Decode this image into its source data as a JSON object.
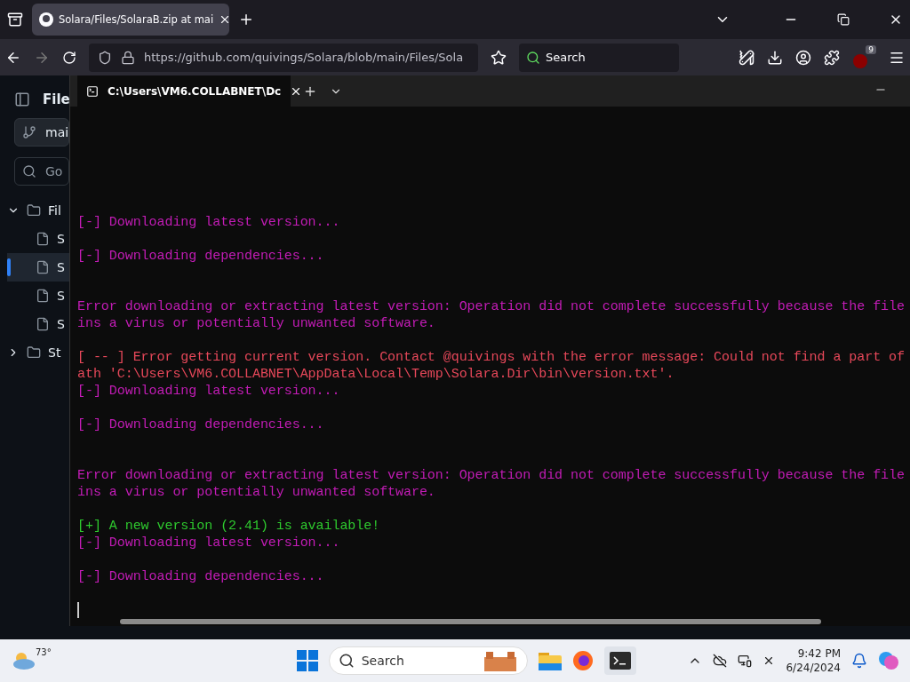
{
  "browser": {
    "tab_title": "Solara/Files/SolaraB.zip at mai",
    "url": "https://github.com/quivings/Solara/blob/main/Files/Sola",
    "search_placeholder": "Search",
    "extension_badge": "9"
  },
  "sidebar": {
    "header": "File",
    "branch": "mai",
    "filter_placeholder": "Go",
    "tree": [
      {
        "kind": "folder",
        "label": "Fil",
        "expanded": true,
        "selected": false,
        "children": [
          {
            "kind": "file",
            "label": "S",
            "selected": false
          },
          {
            "kind": "file",
            "label": "S",
            "selected": true
          },
          {
            "kind": "file",
            "label": "S",
            "selected": false
          },
          {
            "kind": "file",
            "label": "S",
            "selected": false
          }
        ]
      },
      {
        "kind": "folder",
        "label": "St",
        "expanded": false,
        "selected": false
      }
    ]
  },
  "terminal": {
    "tab_title": "C:\\Users\\VM6.COLLABNET\\Dc",
    "lines": [
      {
        "kind": "info",
        "text": "[-] Downloading latest version..."
      },
      {
        "kind": "blank"
      },
      {
        "kind": "info",
        "text": "[-] Downloading dependencies..."
      },
      {
        "kind": "blank"
      },
      {
        "kind": "blank"
      },
      {
        "kind": "info",
        "text": "Error downloading or extracting latest version: Operation did not complete successfully because the file"
      },
      {
        "kind": "info",
        "text": "ins a virus or potentially unwanted software."
      },
      {
        "kind": "blank"
      },
      {
        "kind": "error",
        "text": "[ -- ] Error getting current version. Contact @quivings with the error message: Could not find a part of"
      },
      {
        "kind": "error",
        "text": "ath 'C:\\Users\\VM6.COLLABNET\\AppData\\Local\\Temp\\Solara.Dir\\bin\\version.txt'."
      },
      {
        "kind": "info",
        "text": "[-] Downloading latest version..."
      },
      {
        "kind": "blank"
      },
      {
        "kind": "info",
        "text": "[-] Downloading dependencies..."
      },
      {
        "kind": "blank"
      },
      {
        "kind": "blank"
      },
      {
        "kind": "info",
        "text": "Error downloading or extracting latest version: Operation did not complete successfully because the file"
      },
      {
        "kind": "info",
        "text": "ins a virus or potentially unwanted software."
      },
      {
        "kind": "blank"
      },
      {
        "kind": "success",
        "text": "[+] A new version (2.41) is available!"
      },
      {
        "kind": "info",
        "text": "[-] Downloading latest version..."
      },
      {
        "kind": "blank"
      },
      {
        "kind": "info",
        "text": "[-] Downloading dependencies..."
      },
      {
        "kind": "blank"
      },
      {
        "kind": "cursor"
      }
    ]
  },
  "taskbar": {
    "temperature": "73°",
    "search_placeholder": "Search",
    "time": "9:42 PM",
    "date": "6/24/2024"
  }
}
